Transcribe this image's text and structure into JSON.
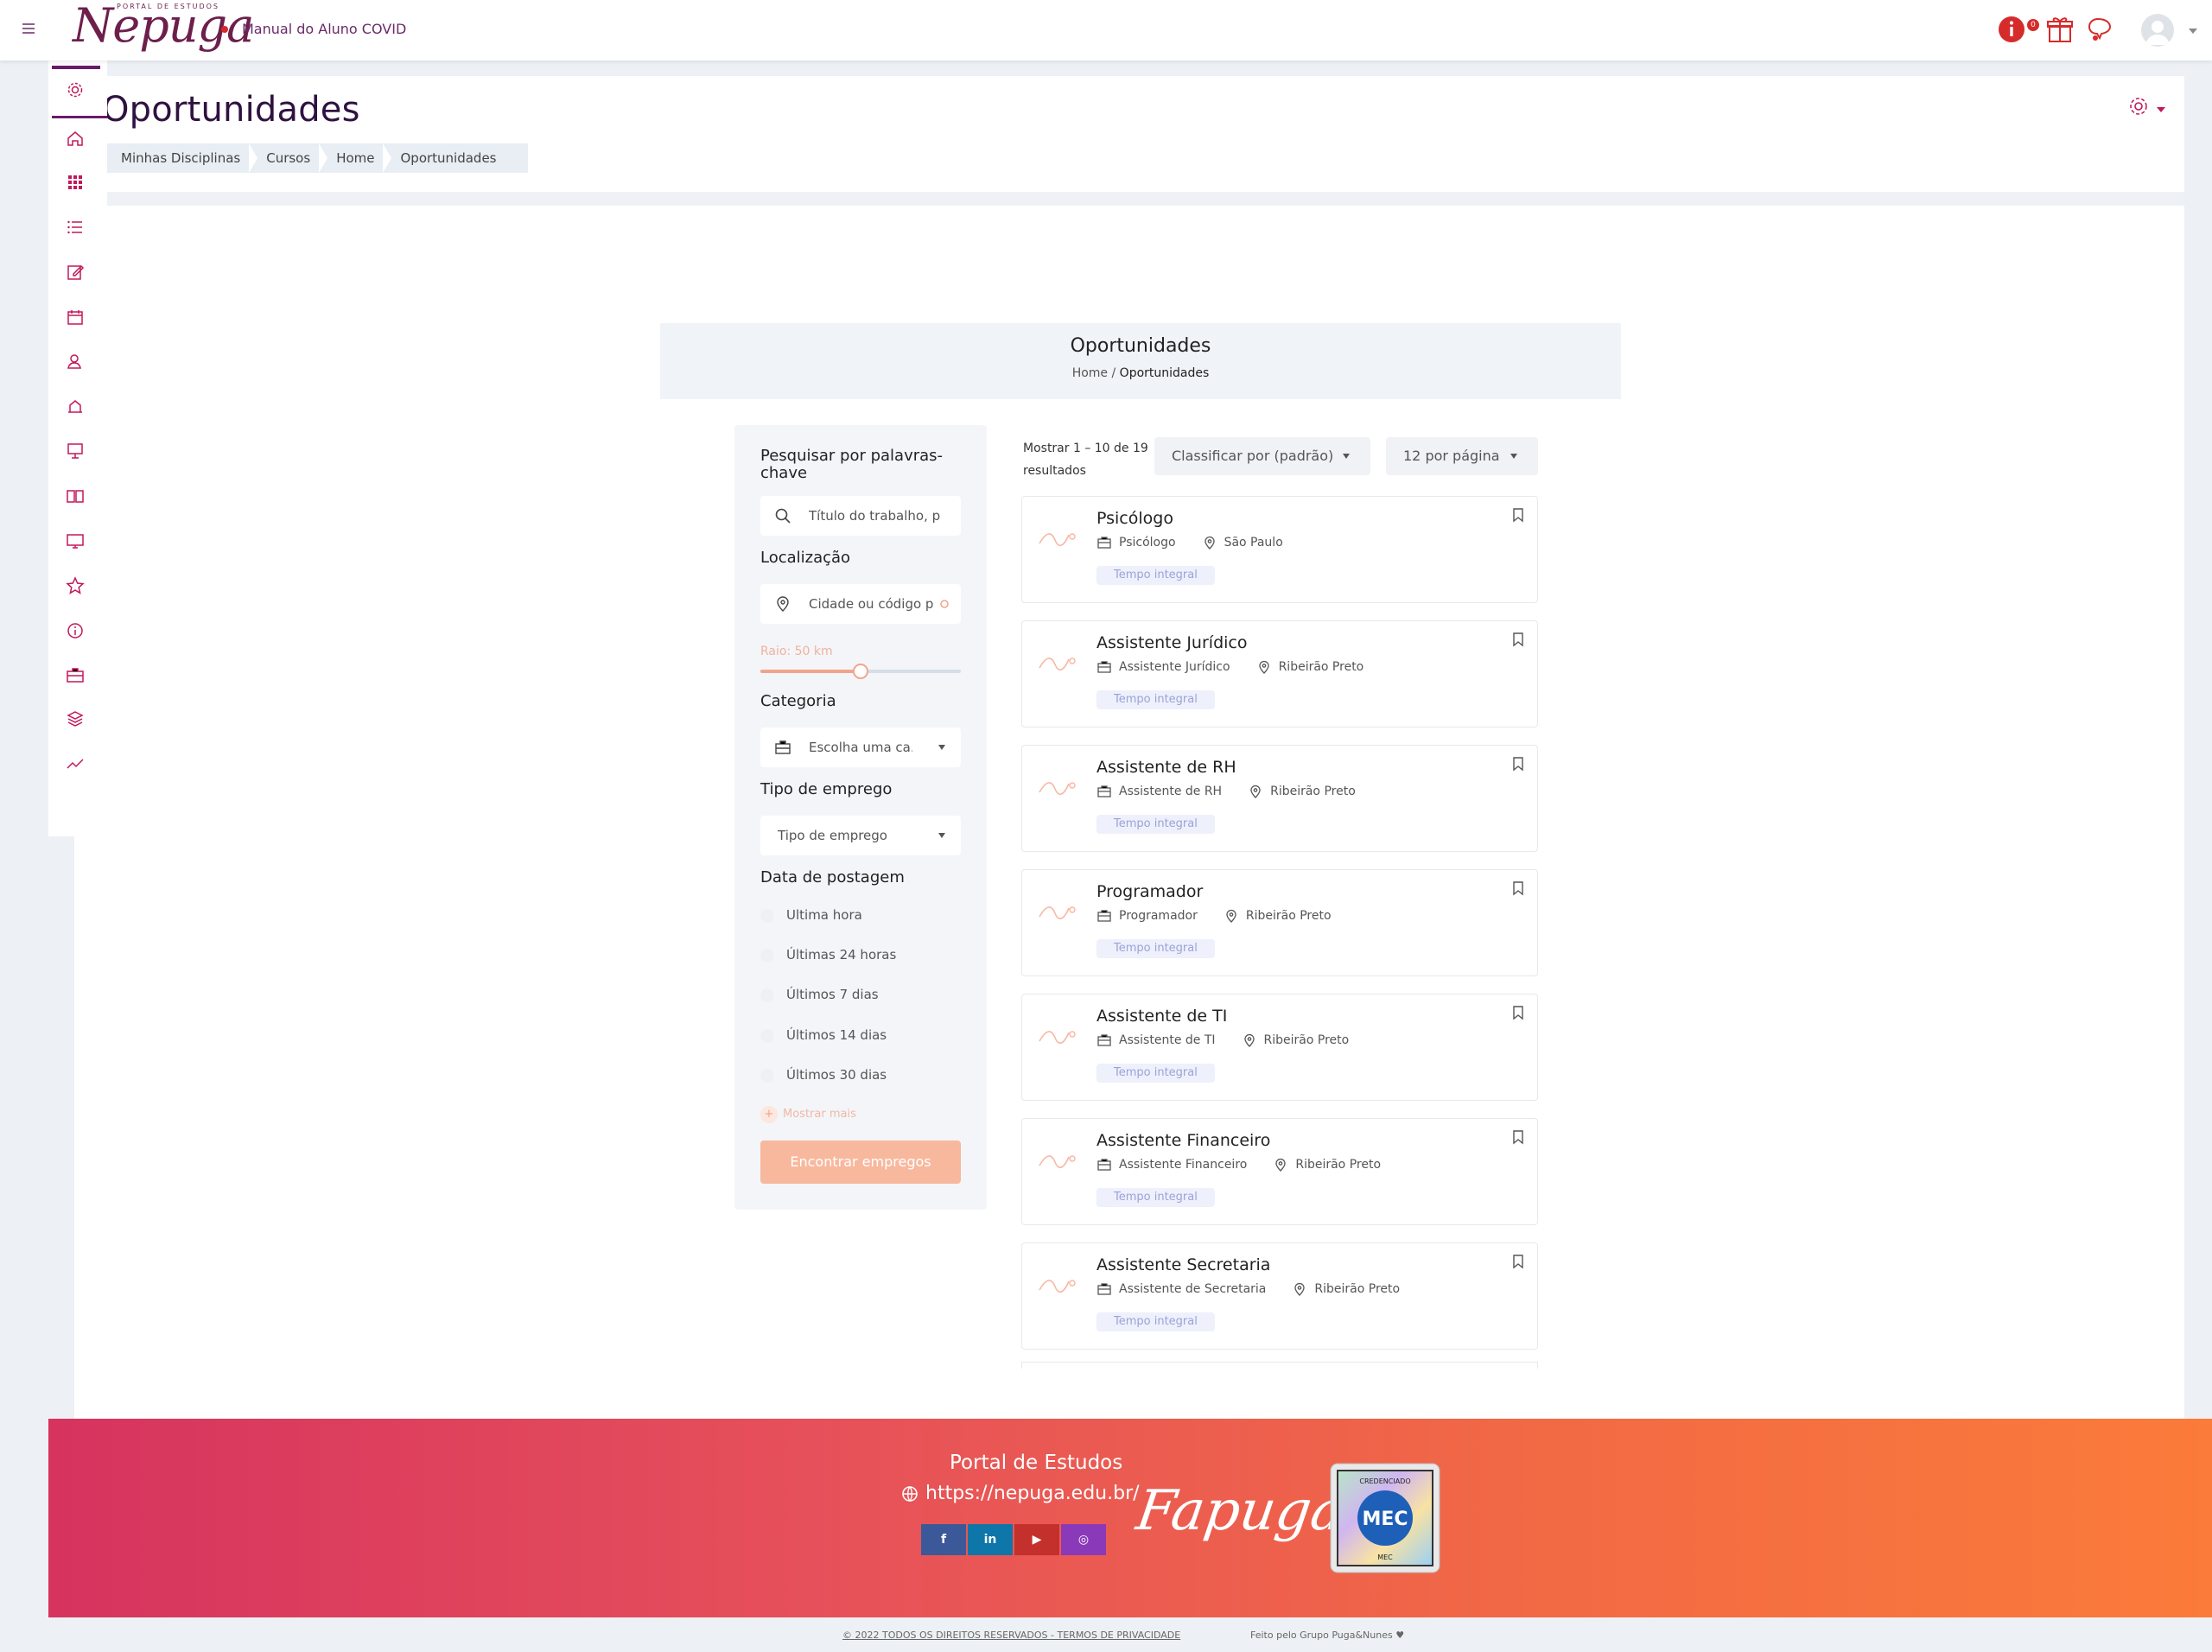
{
  "navbar": {
    "logo_small": "PORTAL DE ESTUDOS",
    "logo_main": "Nepuga",
    "course_link": "Manual do Aluno COVID",
    "notification_count": "0"
  },
  "sidebar": {
    "items": [
      "gear-icon",
      "home-icon",
      "apps-icon",
      "list-icon",
      "edit-icon",
      "calendar-icon",
      "user-search-icon",
      "diploma-icon",
      "presentation-icon",
      "book-icon",
      "monitor-icon",
      "star-icon",
      "info-icon",
      "briefcase-icon",
      "layers-icon",
      "trend-icon"
    ]
  },
  "header": {
    "title": "Oportunidades",
    "breadcrumb": [
      "Minhas Disciplinas",
      "Cursos",
      "Home",
      "Oportunidades"
    ]
  },
  "banner": {
    "title": "Oportunidades",
    "crumb_home": "Home",
    "crumb_sep": "/",
    "crumb_current": "Oportunidades"
  },
  "filters": {
    "keywords_label": "Pesquisar por palavras-chave",
    "keywords_placeholder": "Título do trabalho, p",
    "location_label": "Localização",
    "location_placeholder": "Cidade ou código p",
    "radius_label": "Raio: 50 km",
    "radius_fraction": 0.5,
    "category_label": "Categoria",
    "category_placeholder": "Escolha uma ca...",
    "type_label": "Tipo de emprego",
    "type_placeholder": "Tipo de emprego",
    "date_label": "Data de postagem",
    "date_options": [
      "Ultima hora",
      "Últimas 24 horas",
      "Últimos 7 dias",
      "Últimos 14 dias",
      "Últimos 30 dias"
    ],
    "show_more": "Mostrar mais",
    "submit": "Encontrar empregos"
  },
  "results": {
    "info": "Mostrar 1 – 10 de 19 resultados",
    "sort": "Classificar por (padrão)",
    "per_page": "12 por página"
  },
  "jobs": [
    {
      "title": "Psicólogo",
      "category": "Psicólogo",
      "location": "São Paulo",
      "tag": "Tempo integral"
    },
    {
      "title": "Assistente Jurídico",
      "category": "Assistente Jurídico",
      "location": "Ribeirão Preto",
      "tag": "Tempo integral"
    },
    {
      "title": "Assistente de RH",
      "category": "Assistente de RH",
      "location": "Ribeirão Preto",
      "tag": "Tempo integral"
    },
    {
      "title": "Programador",
      "category": "Programador",
      "location": "Ribeirão Preto",
      "tag": "Tempo integral"
    },
    {
      "title": "Assistente de TI",
      "category": "Assistente de TI",
      "location": "Ribeirão Preto",
      "tag": "Tempo integral"
    },
    {
      "title": "Assistente Financeiro",
      "category": "Assistente Financeiro",
      "location": "Ribeirão Preto",
      "tag": "Tempo integral"
    },
    {
      "title": "Assistente Secretaria",
      "category": "Assistente de Secretaria",
      "location": "Ribeirão Preto",
      "tag": "Tempo integral"
    }
  ],
  "footer": {
    "title": "Portal de Estudos",
    "url": "https://nepuga.edu.br/",
    "brand": "Fapuga",
    "mec_top": "CREDENCIADO",
    "mec_main": "MEC",
    "mec_bottom": "MEC",
    "social": [
      "f",
      "in",
      "▶",
      "◎"
    ],
    "copyright": "© 2022 TODOS OS DIREITOS RESERVADOS - TERMOS DE PRIVACIDADE",
    "made_by": "Feito pelo Grupo Puga&Nunes ♥"
  },
  "colors": {
    "brand_purple": "#6a1a6a",
    "accent_orange": "#f8b89e",
    "footer_start": "#d6335f",
    "footer_end": "#fb7b3a"
  }
}
